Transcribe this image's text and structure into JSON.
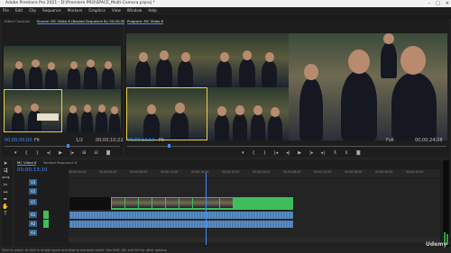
{
  "app": {
    "title": "Adobe Premiere Pro 2021 - D:\\Premiere PRO\\SPACE_Multi-Camera.prproj *",
    "menu": [
      "File",
      "Edit",
      "Clip",
      "Sequence",
      "Markers",
      "Graphics",
      "View",
      "Window",
      "Help"
    ],
    "window_controls": {
      "minimize": "–",
      "maximize": "□",
      "close": "✕"
    }
  },
  "source_monitor": {
    "tabs": [
      "Effect Controls",
      "Source: MC Video 6 (Nested Sequence 6): 00;00;00;00"
    ],
    "timecode_left": "00;00;00;00",
    "fit": "Fit",
    "fraction": "1/2",
    "timecode_right": "00;00;10;22"
  },
  "program_monitor": {
    "tab": "Program: MC Video 6",
    "timecode_left": "00;00;13;10",
    "fit": "Fit",
    "fraction": "Full",
    "timecode_right": "00;00;24;28"
  },
  "timeline": {
    "tab": "MC Video 6",
    "tab2": "Nested Sequence 6",
    "timecode": "00;00;13;10",
    "ruler": [
      "00;00;00;00",
      "00;00;04;00",
      "00;00;08;00",
      "00;00;12;00",
      "00;00;16;00",
      "00;00;20;00",
      "00;00;24;00",
      "00;00;28;00",
      "00;00;32;00",
      "00;00;36;00",
      "00;00;40;00",
      "00;00;44;00"
    ],
    "video_tracks": [
      "V3",
      "V2",
      "V1"
    ],
    "audio_tracks": [
      "A1",
      "A2",
      "A3"
    ],
    "playhead": 0.37
  },
  "status_text": "Click to select, or click in empty space and drag to marquee select. Use Shift, Alt, and Ctrl for other options.",
  "watermark": "Udemy",
  "colors": {
    "accent": "#3b8cff",
    "video_clip": "#3fbd5c",
    "audio_clip": "#4a7fb5",
    "frame": "#e3d24a"
  }
}
